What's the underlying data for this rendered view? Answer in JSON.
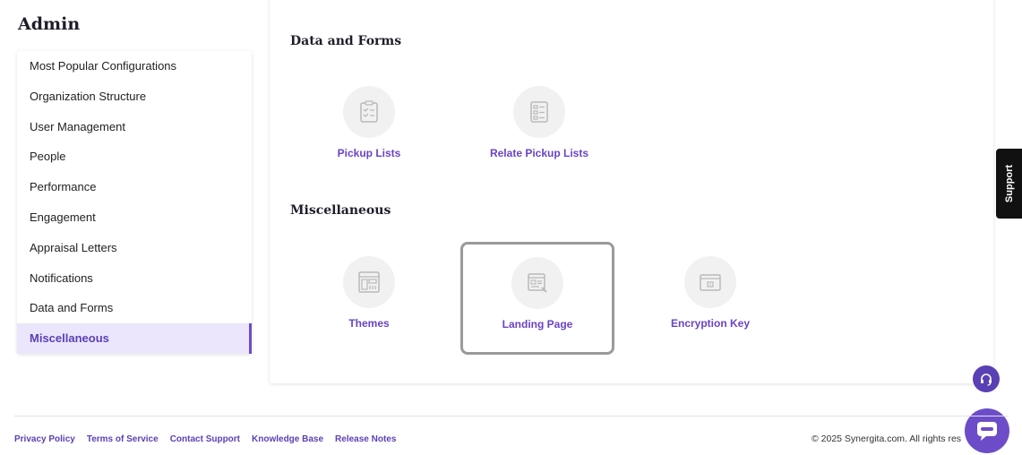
{
  "header": {
    "title": "Admin"
  },
  "sidebar": {
    "items": [
      {
        "label": "Most Popular Configurations"
      },
      {
        "label": "Organization Structure"
      },
      {
        "label": "User Management"
      },
      {
        "label": "People"
      },
      {
        "label": "Performance"
      },
      {
        "label": "Engagement"
      },
      {
        "label": "Appraisal Letters"
      },
      {
        "label": "Notifications"
      },
      {
        "label": "Data and Forms"
      },
      {
        "label": "Miscellaneous"
      }
    ],
    "active_item": "Miscellaneous"
  },
  "main": {
    "sections": [
      {
        "title": "Data and Forms",
        "tiles": [
          {
            "label": "Pickup Lists",
            "icon": "checklist-icon"
          },
          {
            "label": "Relate Pickup Lists",
            "icon": "list-document-icon"
          }
        ]
      },
      {
        "title": "Miscellaneous",
        "tiles": [
          {
            "label": "Themes",
            "icon": "layout-icon"
          },
          {
            "label": "Landing Page",
            "icon": "page-edit-icon"
          },
          {
            "label": "Encryption Key",
            "icon": "key-box-icon"
          }
        ]
      }
    ]
  },
  "support": {
    "label": "Support"
  },
  "footer": {
    "links": [
      {
        "label": "Privacy Policy"
      },
      {
        "label": "Terms of Service"
      },
      {
        "label": "Contact Support"
      },
      {
        "label": "Knowledge Base"
      },
      {
        "label": "Release Notes"
      }
    ],
    "copyright": "© 2025 Synergita.com. All rights res"
  },
  "colors": {
    "accent": "#6a43c4",
    "active_bg": "#ebe6fb",
    "support_bg": "#111111"
  }
}
